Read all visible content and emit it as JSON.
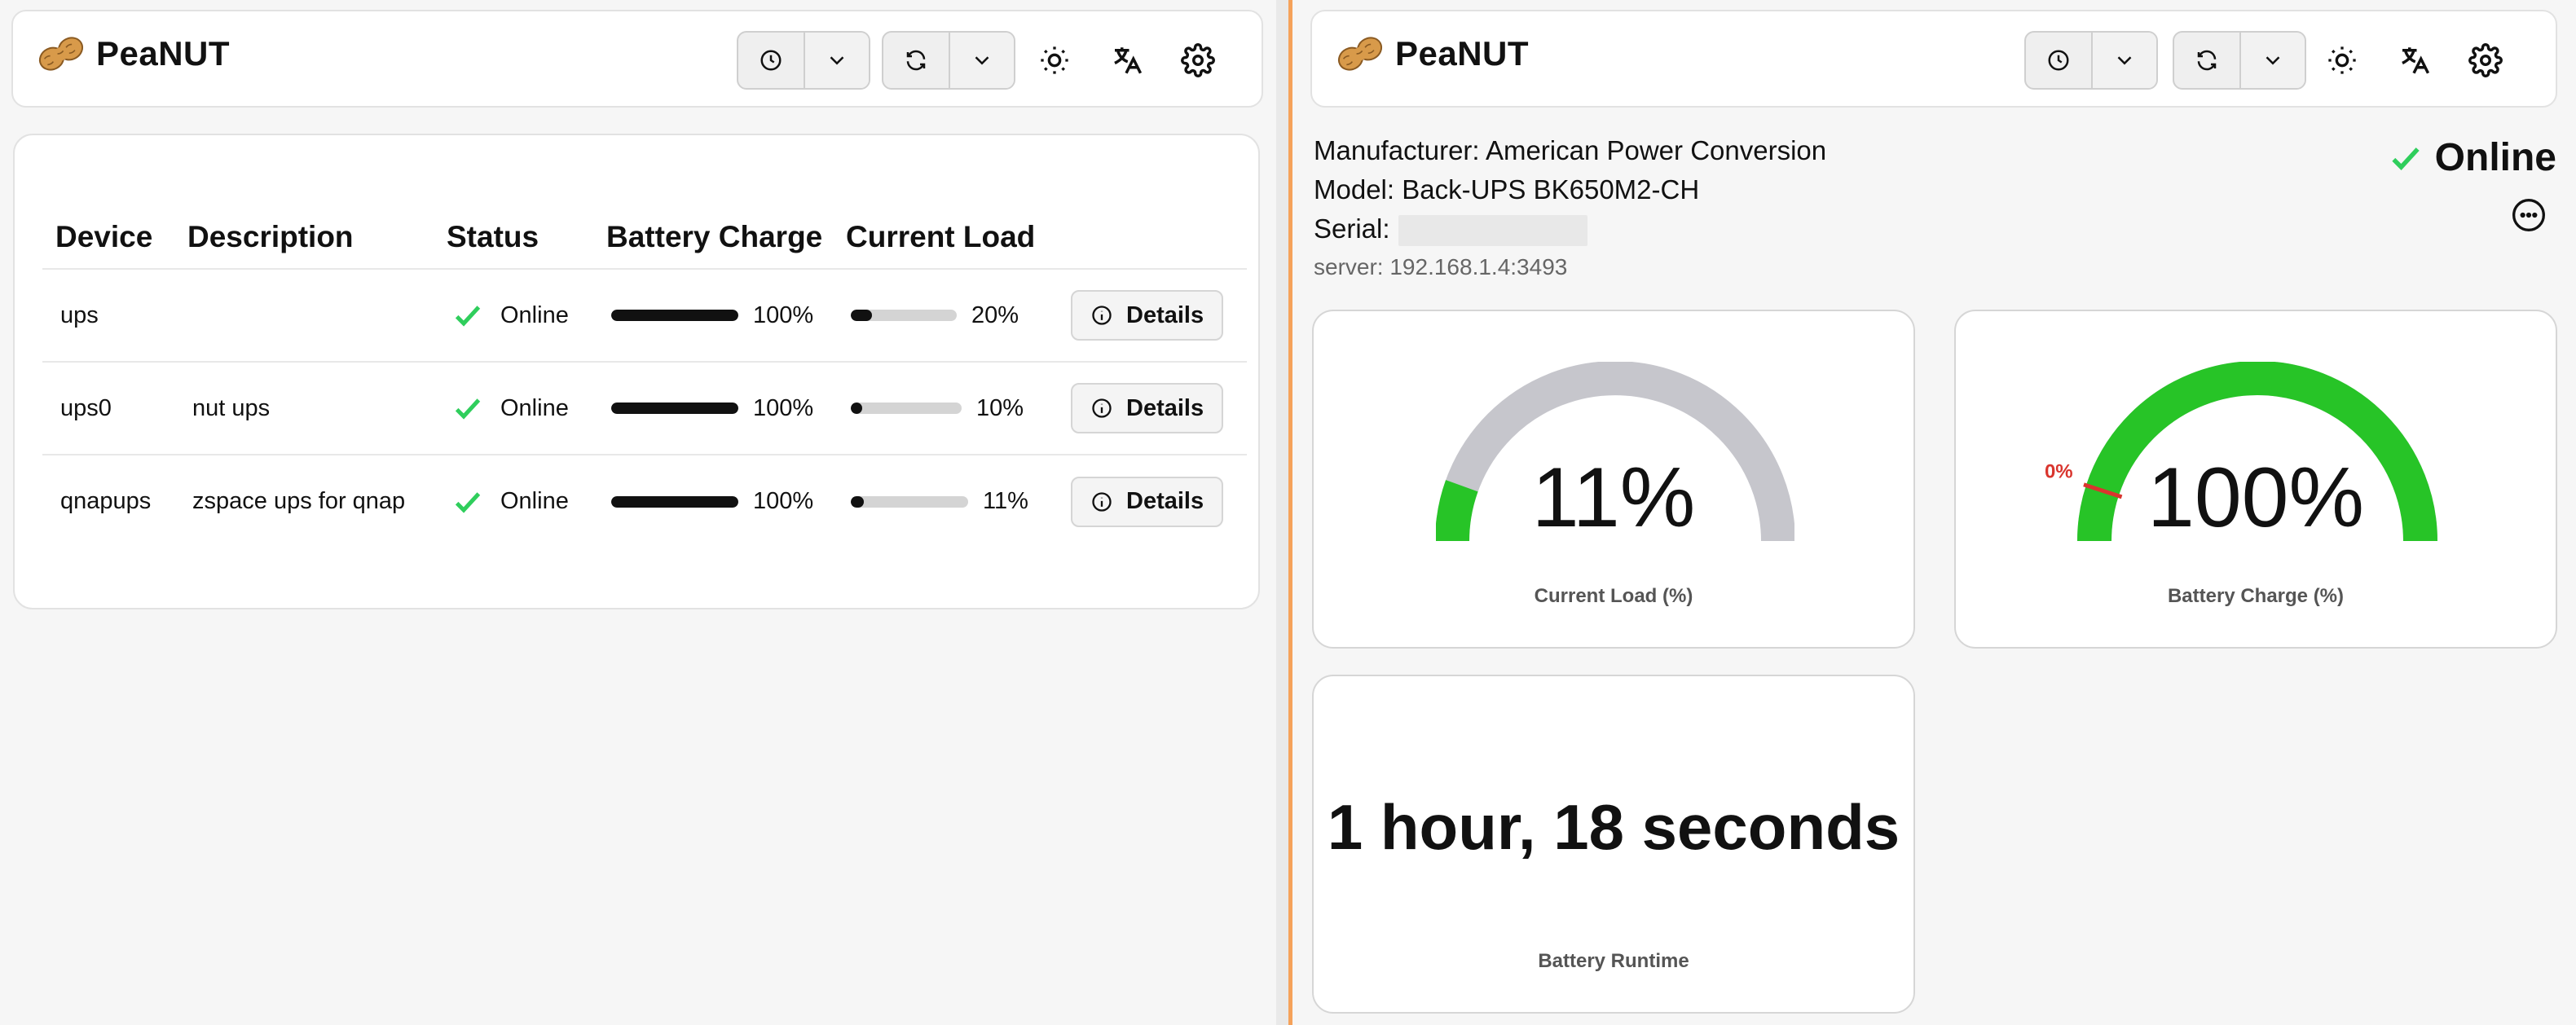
{
  "app": {
    "name": "PeaNUT"
  },
  "colors": {
    "accent_green": "#27c427",
    "check_green": "#2fce5c",
    "warning_red": "#d9352e",
    "track_gray": "#c6c6cc",
    "divider_orange": "#f5a25a"
  },
  "header": {
    "icons": [
      "clock-icon",
      "chevron-down-icon",
      "refresh-icon",
      "chevron-down-icon",
      "sun-icon",
      "translate-icon",
      "gear-icon"
    ]
  },
  "table": {
    "columns": [
      "Device",
      "Description",
      "Status",
      "Battery Charge",
      "Current Load"
    ],
    "rows": [
      {
        "device": "ups",
        "description": "",
        "status": "Online",
        "battery_charge": 100,
        "battery_label": "100%",
        "current_load": 20,
        "load_label": "20%",
        "action": "Details"
      },
      {
        "device": "ups0",
        "description": "nut ups",
        "status": "Online",
        "battery_charge": 100,
        "battery_label": "100%",
        "current_load": 10,
        "load_label": "10%",
        "action": "Details"
      },
      {
        "device": "qnapups",
        "description": "zspace ups for qnap",
        "status": "Online",
        "battery_charge": 100,
        "battery_label": "100%",
        "current_load": 11,
        "load_label": "11%",
        "action": "Details"
      }
    ]
  },
  "device_detail": {
    "manufacturer_line": "Manufacturer: American Power Conversion",
    "model_line": "Model: Back-UPS BK650M2-CH",
    "serial_label": "Serial:",
    "server_line": "server: 192.168.1.4:3493",
    "status": "Online",
    "load_gauge": {
      "value": 11,
      "value_label": "11%",
      "label": "Current Load (%)"
    },
    "charge_gauge": {
      "value": 100,
      "value_label": "100%",
      "label": "Battery Charge (%)",
      "threshold": 10,
      "threshold_label": "10%"
    },
    "runtime": {
      "value_label": "1 hour, 18 seconds",
      "label": "Battery Runtime"
    }
  }
}
